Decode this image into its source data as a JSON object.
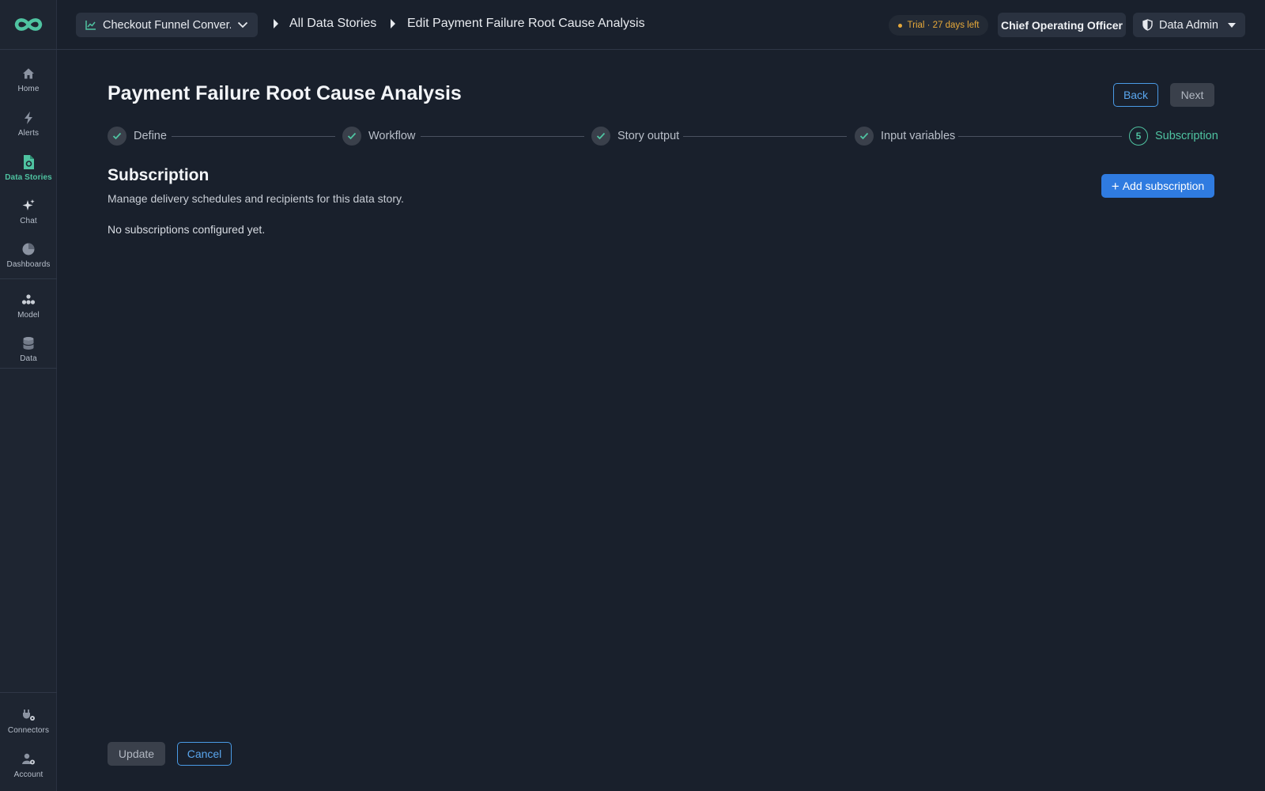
{
  "sidebar": {
    "items": [
      {
        "label": "Home",
        "icon": "home-icon"
      },
      {
        "label": "Alerts",
        "icon": "bolt-icon"
      },
      {
        "label": "Data Stories",
        "icon": "document-icon",
        "active": true
      },
      {
        "label": "Chat",
        "icon": "sparkle-icon"
      },
      {
        "label": "Dashboards",
        "icon": "pie-chart-icon"
      },
      {
        "label": "Model",
        "icon": "model-icon"
      },
      {
        "label": "Data",
        "icon": "database-icon"
      }
    ],
    "bottom_items": [
      {
        "label": "Connectors",
        "icon": "plug-icon"
      },
      {
        "label": "Account",
        "icon": "user-gear-icon"
      }
    ]
  },
  "topbar": {
    "model_select": "Checkout Funnel Conver...",
    "breadcrumb": [
      "All Data Stories",
      "Edit Payment Failure Root Cause Analysis"
    ],
    "trial": "Trial · 27 days left",
    "role": "Chief Operating Officer",
    "user_role": "Data Admin"
  },
  "main": {
    "title": "Payment Failure Root Cause Analysis",
    "back_label": "Back",
    "next_label": "Next",
    "steps": [
      {
        "label": "Define",
        "status": "complete"
      },
      {
        "label": "Workflow",
        "status": "complete"
      },
      {
        "label": "Story output",
        "status": "complete"
      },
      {
        "label": "Input variables",
        "status": "complete"
      },
      {
        "label": "Subscription",
        "status": "active",
        "number": "5"
      }
    ],
    "section_title": "Subscription",
    "section_desc": "Manage delivery schedules and recipients for this data story.",
    "add_label": "Add subscription",
    "empty_message": "No subscriptions configured yet.",
    "update_label": "Update",
    "cancel_label": "Cancel"
  },
  "colors": {
    "accent": "#4fc3a1",
    "primary": "#2f7be0",
    "link": "#5aa6ee",
    "trial": "#e7a93a",
    "background": "#19202c"
  }
}
